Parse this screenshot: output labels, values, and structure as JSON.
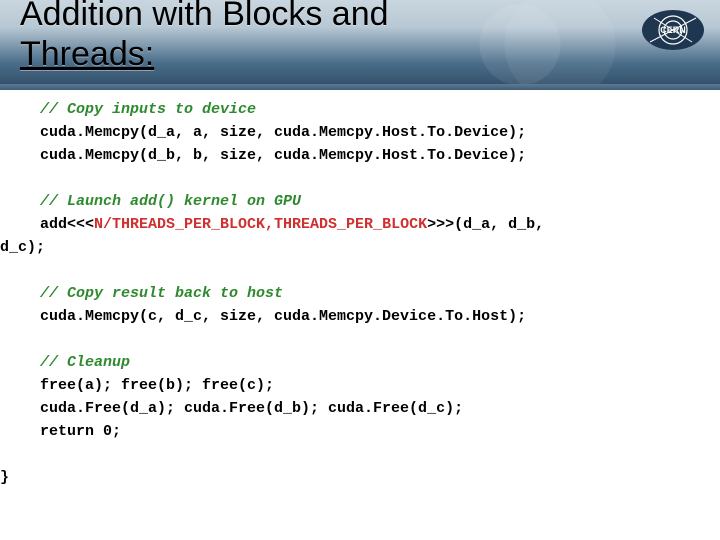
{
  "header": {
    "title_line1": "Addition with Blocks and",
    "title_line2_underlined": "Threads:",
    "logo_label": "CERN"
  },
  "code": {
    "c1": "// Copy inputs to device",
    "l1": "cuda.Memcpy(d_a, a, size, cuda.Memcpy.Host.To.Device);",
    "l2": "cuda.Memcpy(d_b, b, size, cuda.Memcpy.Host.To.Device);",
    "c2": "// Launch add() kernel on GPU",
    "l3a": "add<<<",
    "l3b": "N/THREADS_PER_BLOCK,THREADS_PER_BLOCK",
    "l3c": ">>>(d_a, d_b,",
    "l3d": "d_c);",
    "c3": "// Copy result back to host",
    "l4": "cuda.Memcpy(c, d_c, size, cuda.Memcpy.Device.To.Host);",
    "c4": "// Cleanup",
    "l5": "free(a); free(b); free(c);",
    "l6": "cuda.Free(d_a); cuda.Free(d_b); cuda.Free(d_c);",
    "l7": "return 0;",
    "l8": "}"
  }
}
